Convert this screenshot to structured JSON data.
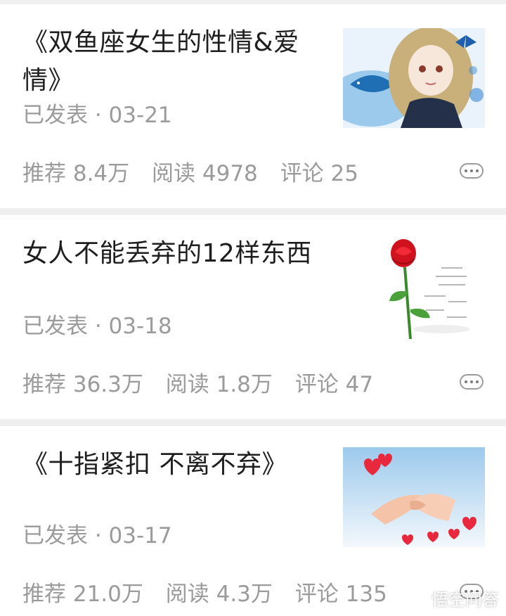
{
  "articles": [
    {
      "title": "《双鱼座女生的性情&爱情》",
      "date": "已发表 · 03-21",
      "recommend": "推荐 8.4万",
      "reads": "阅读 4978",
      "comments": "评论 25",
      "thumb_icon": "anime-girl-with-fish-image"
    },
    {
      "title": "女人不能丢弃的12样东西",
      "date": "已发表 · 03-18",
      "recommend": "推荐 36.3万",
      "reads": "阅读 1.8万",
      "comments": "评论 47",
      "thumb_icon": "red-rose-image"
    },
    {
      "title": "《十指紧扣 不离不弃》",
      "date": "已发表 · 03-17",
      "recommend": "推荐 21.0万",
      "reads": "阅读 4.3万",
      "comments": "评论 135",
      "thumb_icon": "holding-hands-hearts-image"
    }
  ],
  "more_icon": "more-dots-icon",
  "watermark": {
    "text": "悟空问答",
    "icon": "wukong-logo-icon"
  },
  "colors": {
    "title": "#1e1e1e",
    "meta": "#9b9b9b",
    "separator": "#efefef",
    "heart": "#e8283c"
  }
}
